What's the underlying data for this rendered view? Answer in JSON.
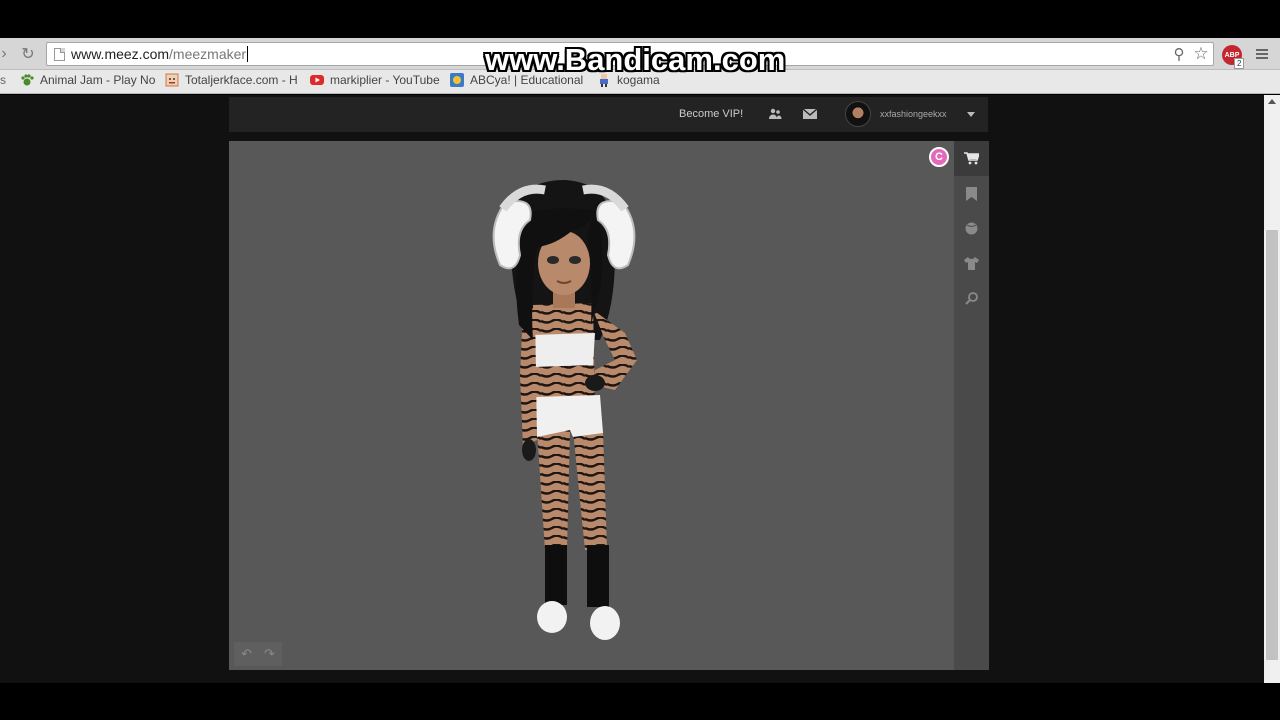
{
  "browser": {
    "url_host": "www.meez.com",
    "url_path": "/meezmaker",
    "abp_label": "ABP",
    "abp_count": "2",
    "bookmarks": [
      {
        "label": "Animal Jam - Play No",
        "icon": "paw-icon",
        "color": "#4a8c2a"
      },
      {
        "label": "Totaljerkface.com - H",
        "icon": "face-icon",
        "color": "#c8784a"
      },
      {
        "label": "markiplier - YouTube",
        "icon": "youtube-icon",
        "color": "#e02a2a"
      },
      {
        "label": "ABCya! | Educational",
        "icon": "abcya-icon",
        "color": "#3a7ac8"
      },
      {
        "label": "kogama",
        "icon": "kogama-icon",
        "color": "#4a6ac8"
      }
    ],
    "bookmark_edge_label": "s"
  },
  "watermark": "www.Bandicam.com",
  "site": {
    "become_vip": "Become VIP!",
    "username": "xxfashiongeekxx",
    "coin_label": "C",
    "side_tools": [
      "cart-icon",
      "bookmark-icon",
      "ball-icon",
      "shirt-icon",
      "search-icon"
    ]
  },
  "colors": {
    "stage_bg": "#585858",
    "header_bg": "#232323",
    "coin": "#e36ab9"
  }
}
